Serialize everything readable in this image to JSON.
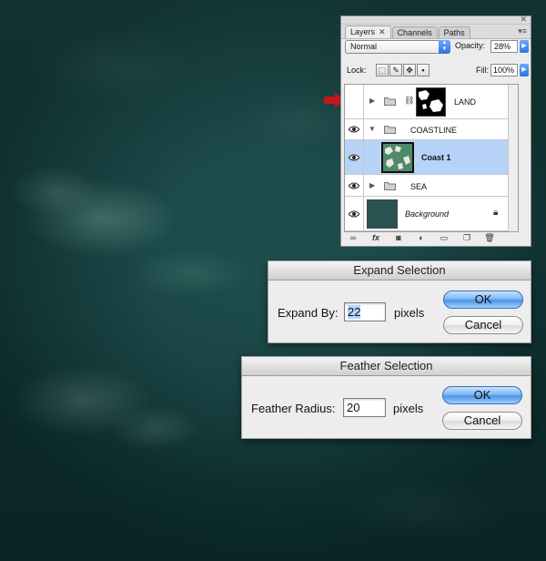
{
  "layers_panel": {
    "tabs": [
      {
        "label": "Layers",
        "close": "✕"
      },
      {
        "label": "Channels"
      },
      {
        "label": "Paths"
      }
    ],
    "panel_menu_icon": "panel-menu-icon",
    "close_glyph": "✕",
    "blend_mode": "Normal",
    "opacity_label": "Opacity:",
    "opacity_value": "28%",
    "lock_label": "Lock:",
    "fill_label": "Fill:",
    "fill_value": "100%",
    "layers": [
      {
        "name": "LAND",
        "type": "group",
        "visible": false,
        "expanded": false,
        "has_mask": true
      },
      {
        "name": "COASTLINE",
        "type": "group",
        "visible": true,
        "expanded": true
      },
      {
        "name": "Coast 1",
        "type": "layer",
        "visible": true,
        "selected": true
      },
      {
        "name": "SEA",
        "type": "group",
        "visible": true,
        "expanded": false
      },
      {
        "name": "Background",
        "type": "background",
        "visible": true,
        "locked": true
      }
    ],
    "bottom_icons": [
      "link-icon",
      "fx-icon",
      "mask-icon",
      "adjustment-icon",
      "new-group-icon",
      "new-layer-icon",
      "trash-icon"
    ],
    "fx_label": "fx"
  },
  "expand_dialog": {
    "title": "Expand Selection",
    "field_label": "Expand By:",
    "value": "22",
    "unit": "pixels",
    "ok_label": "OK",
    "cancel_label": "Cancel"
  },
  "feather_dialog": {
    "title": "Feather Selection",
    "field_label": "Feather Radius:",
    "value": "20",
    "unit": "pixels",
    "ok_label": "OK",
    "cancel_label": "Cancel"
  },
  "colors": {
    "selection_blue": "#b7d3f8",
    "default_button_blue": "#4f94e6",
    "annotation_arrow_red": "#c4161c",
    "canvas_teal": "#1c4848"
  }
}
